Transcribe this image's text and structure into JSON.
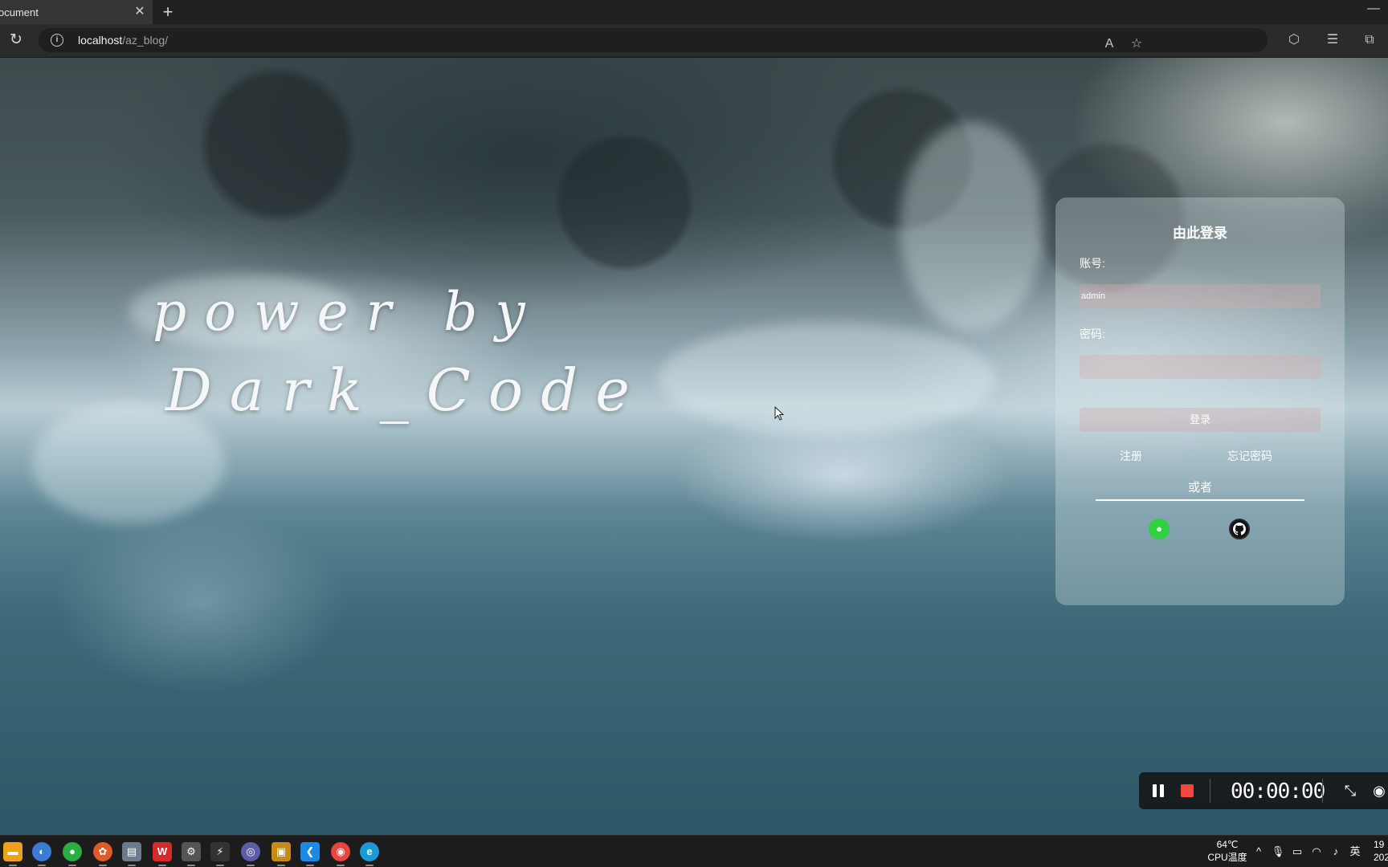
{
  "browser": {
    "tab_title": "ocument",
    "tab_close_icon": "close-icon",
    "new_tab_icon": "plus-icon",
    "url_host": "localhost",
    "url_path": "/az_blog/",
    "window_control": "—"
  },
  "hero": {
    "line1": "power by",
    "line2": "Dark_Code"
  },
  "login": {
    "title": "由此登录",
    "account_label": "账号:",
    "account_value": "admin",
    "password_label": "密码:",
    "password_value": "",
    "submit_label": "登录",
    "register_link": "注册",
    "forgot_link": "忘记密码",
    "or_label": "或者",
    "wechat_glyph": "●",
    "github_glyph": "⌂"
  },
  "recorder": {
    "timer": "00:00:00"
  },
  "taskbar": {
    "temperature": "64℃",
    "temp_label": "CPU温度",
    "ime": "英",
    "clock_time": "19",
    "clock_date": "202"
  },
  "colors": {
    "wechat": "#2ed13f",
    "github": "#111111",
    "stop": "#f0483e",
    "panel": "rgba(225,232,236,0.32)"
  }
}
